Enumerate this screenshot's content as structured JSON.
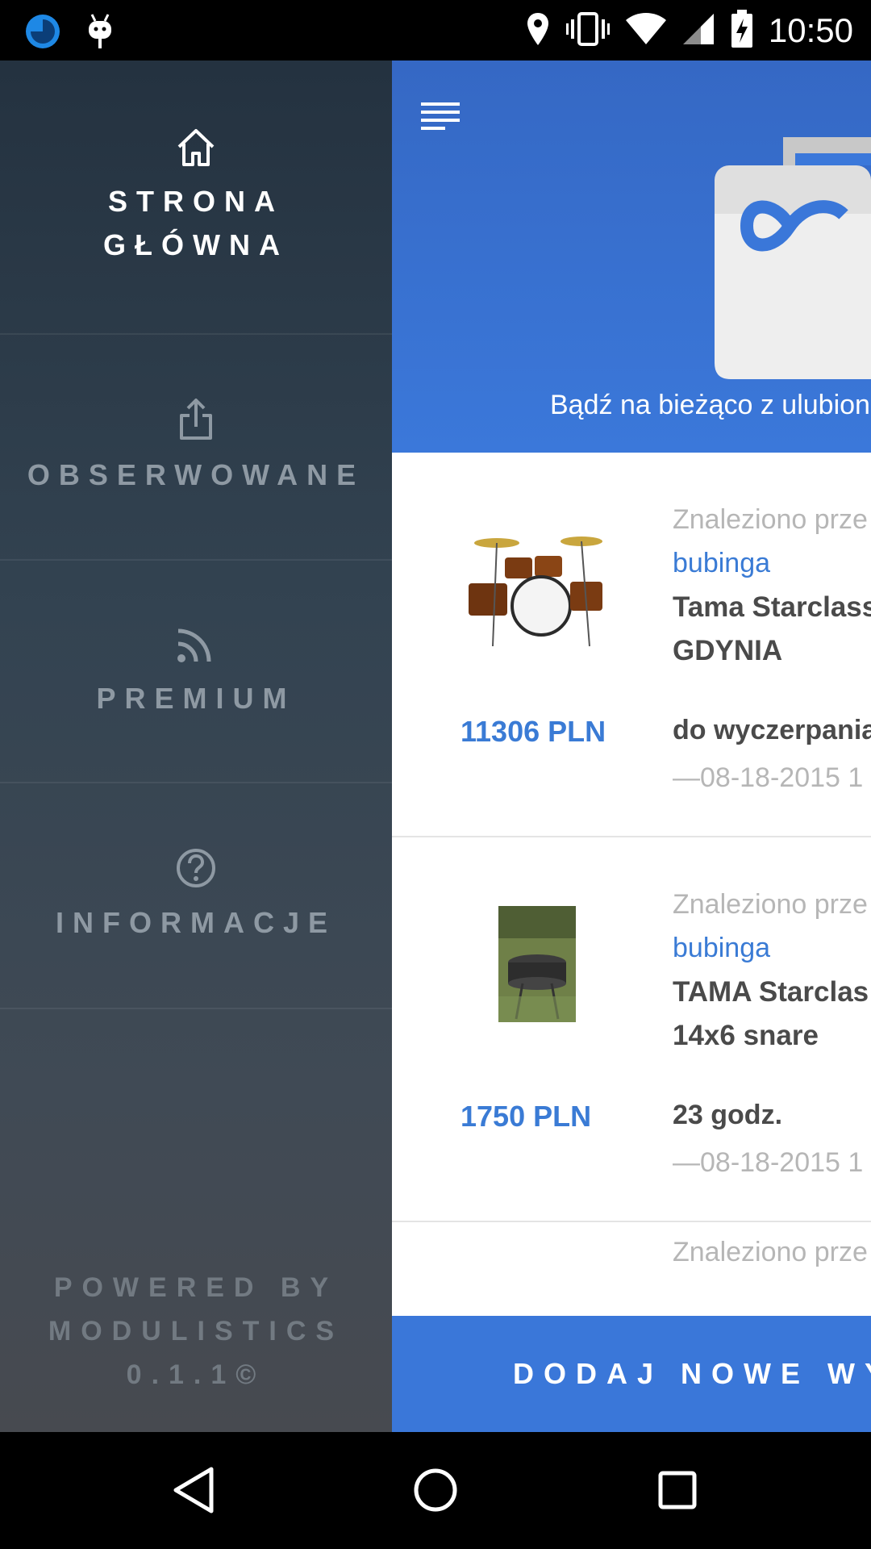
{
  "status_bar": {
    "time": "10:50",
    "left_icons": [
      "pie-progress-icon",
      "android-debug-icon"
    ],
    "right_icons": [
      "location-icon",
      "vibrate-icon",
      "wifi-icon",
      "cell-signal-icon",
      "battery-charging-icon"
    ]
  },
  "drawer": {
    "items": [
      {
        "label": "STRONA GŁÓWNA",
        "line1": "STRONA",
        "line2": "GŁÓWNA",
        "icon": "home-icon",
        "active": true
      },
      {
        "label": "OBSERWOWANE",
        "icon": "share-icon",
        "active": false
      },
      {
        "label": "PREMIUM",
        "icon": "rss-icon",
        "active": false
      },
      {
        "label": "INFORMACJE",
        "icon": "help-icon",
        "active": false
      }
    ],
    "powered": {
      "line1": "POWERED BY",
      "line2": "MODULISTICS",
      "line3": "0.1.1©"
    }
  },
  "main": {
    "hero_caption": "Bądź na bieżąco z ulubion",
    "cards": [
      {
        "found": "Znaleziono prze",
        "tag": "bubinga",
        "title_line1": "Tama Starclass",
        "title_line2": "GDYNIA",
        "price": "11306 PLN",
        "time": "do wyczerpania",
        "date": "—08-18-2015 1"
      },
      {
        "found": "Znaleziono prze",
        "tag": "bubinga",
        "title_line1": "TAMA Starclas",
        "title_line2": "14x6 snare",
        "price": "1750 PLN",
        "time": "23 godz.",
        "date": "—08-18-2015 1"
      },
      {
        "found": "Znaleziono prze"
      }
    ],
    "cta_label": "DODAJ NOWE WY"
  },
  "colors": {
    "accent": "#3a77d9",
    "drawer_top": "#243240",
    "drawer_bottom": "#474a50"
  }
}
